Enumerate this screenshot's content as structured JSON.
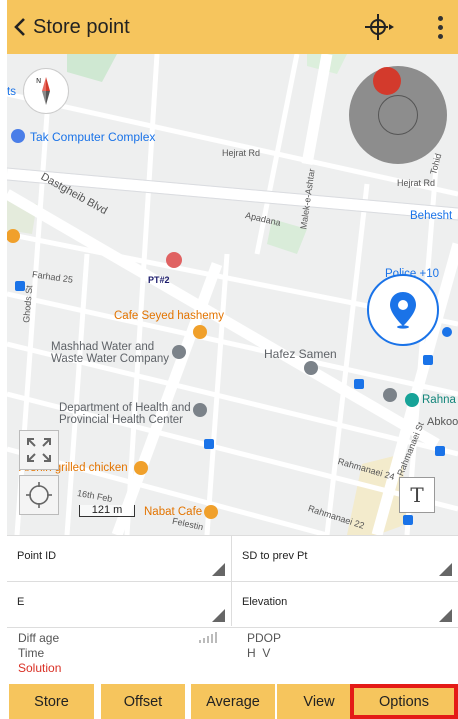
{
  "header": {
    "back_icon": "chevron-left-icon",
    "title": "Store point",
    "crosshair_icon": "crosshair-icon",
    "menu_icon": "more-vertical-icon"
  },
  "map": {
    "streets": [
      "Hejrat Rd",
      "Hejrat Rd",
      "Dastgheib Blvd",
      "Farhad 25",
      "Apadana",
      "Malek-e-Ashtar",
      "Rahmanaei St",
      "Rahmanaei 24",
      "Rahmanaei 22",
      "Felestin",
      "16th Feb",
      "Abkooh",
      "Ghods St",
      "Behesht",
      "Tohid"
    ],
    "pois": {
      "tak": "Tak Computer Complex",
      "cafe_seyed": "Cafe Seyed hashemy",
      "mashhad_water_1": "Mashhad Water and",
      "mashhad_water_2": "Waste Water Company",
      "hafez": "Hafez Samen",
      "dept_health_1": "Department of Health and",
      "dept_health_2": "Provincial Health Center",
      "arshin": "Arshin grilled chicken",
      "nabat": "Nabat Cafe",
      "police": "Police +10",
      "rahna": "Rahna",
      "behesht": "Behesht",
      "pt_label": "PT#2",
      "edge_ts": "ts"
    },
    "scale_label": "121 m",
    "text_button": "T"
  },
  "form": {
    "point_id": "Point ID",
    "sd_prev": "SD to prev Pt",
    "e_field": "E",
    "elevation": "Elevation",
    "diff_age": "Diff age",
    "time": "Time",
    "solution": "Solution",
    "pdop": "PDOP",
    "hv": "H  V"
  },
  "buttons": {
    "store": "Store",
    "offset": "Offset",
    "average": "Average",
    "view": "View",
    "options": "Options"
  },
  "colors": {
    "accent": "#f6c55d",
    "selection": "#e41b17",
    "solution": "#d93025",
    "map_bg": "#eeefef"
  }
}
